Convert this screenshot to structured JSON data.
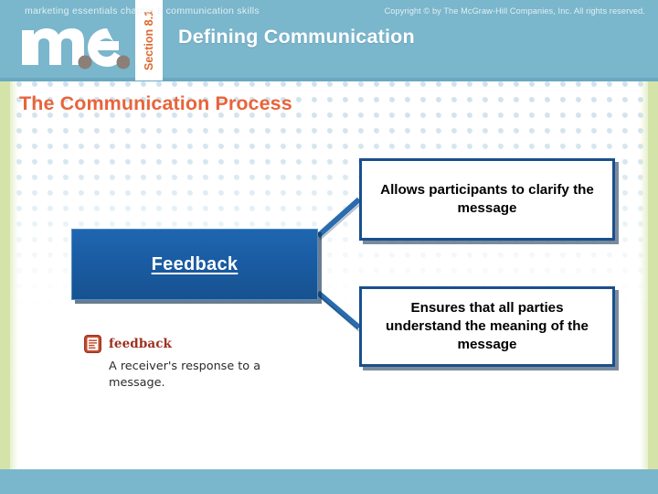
{
  "header": {
    "brand_logo": "me.",
    "section_label": "Section 8.1",
    "title": "Defining Communication",
    "bg_color": "#7ab6cc",
    "accent_color": "#dd6a32"
  },
  "slide": {
    "title": "The Communication Process",
    "title_color": "#e8643c"
  },
  "diagram": {
    "main_node": {
      "label": "Feedback",
      "fill_color": "#1a5ca3",
      "text_color": "#ffffff"
    },
    "detail_nodes": [
      {
        "label": "Allows participants to clarify the message"
      },
      {
        "label": "Ensures that all parties understand the meaning of the message"
      }
    ],
    "connector_color": "#2a6cae"
  },
  "glossary": {
    "icon": "document-icon",
    "term": "feedback",
    "definition": "A receiver's response to a message.",
    "term_color": "#9c3121"
  },
  "footer": {
    "left_text": "marketing essentials  chapter 8  communication skills",
    "right_text": "Copyright © by The McGraw-Hill Companies, Inc. All rights reserved.",
    "bg_color": "#7ab6cc"
  }
}
